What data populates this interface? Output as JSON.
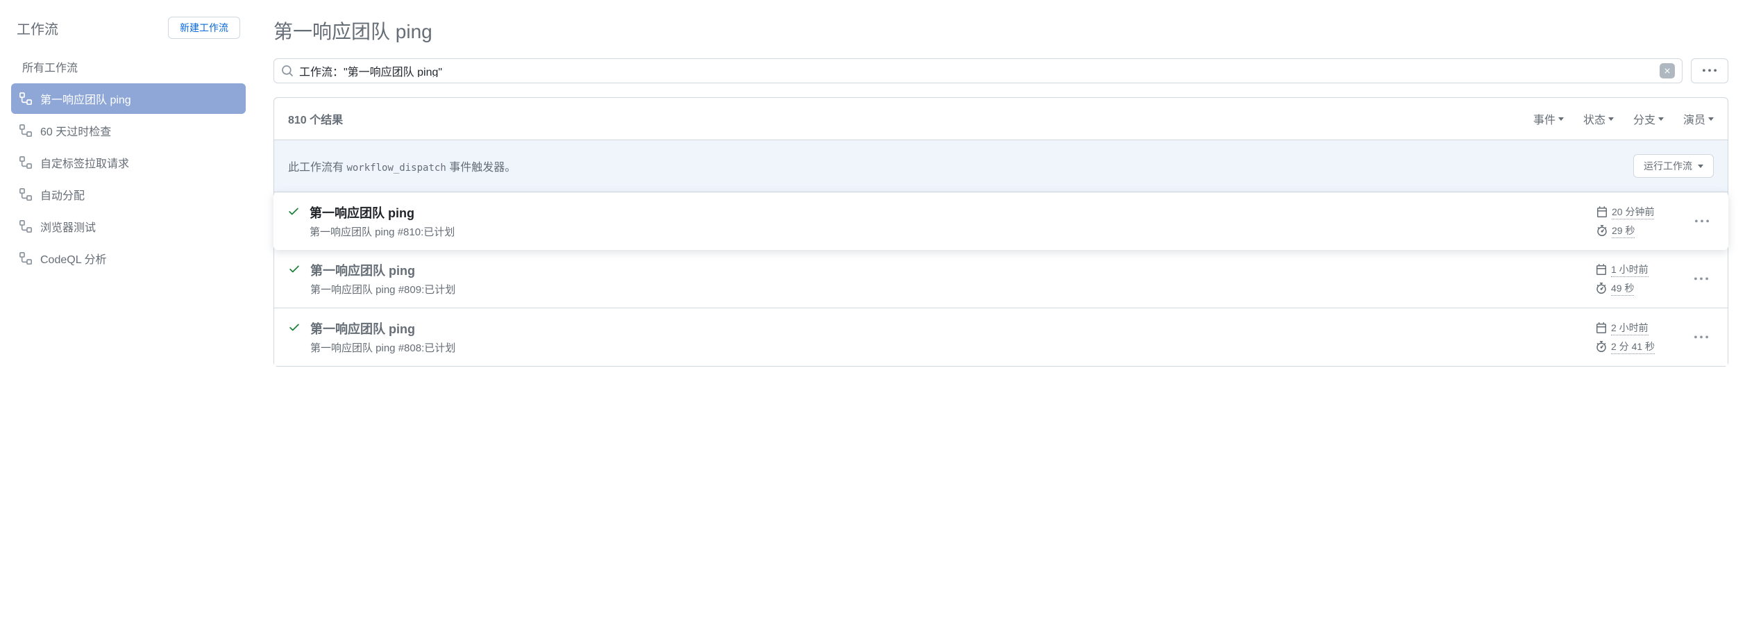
{
  "sidebar": {
    "title": "工作流",
    "new_button": "新建工作流",
    "all_label": "所有工作流",
    "items": [
      {
        "label": "第一响应团队 ping",
        "active": true
      },
      {
        "label": "60 天过时检查",
        "active": false
      },
      {
        "label": "自定标签拉取请求",
        "active": false
      },
      {
        "label": "自动分配",
        "active": false
      },
      {
        "label": "浏览器测试",
        "active": false
      },
      {
        "label": "CodeQL 分析",
        "active": false
      }
    ]
  },
  "page": {
    "title": "第一响应团队 ping",
    "search_value": "工作流：\"第一响应团队 ping\""
  },
  "results": {
    "count_label": "810 个结果",
    "filters": {
      "event": "事件",
      "status": "状态",
      "branch": "分支",
      "actor": "演员"
    },
    "dispatch": {
      "prefix": "此工作流有 ",
      "code": "workflow_dispatch",
      "suffix": " 事件触发器。",
      "run_button": "运行工作流"
    },
    "runs": [
      {
        "title": "第一响应团队 ping",
        "subtitle": "第一响应团队 ping #810:已计划",
        "time": "20 分钟前",
        "duration": "29 秒",
        "elevated": true
      },
      {
        "title": "第一响应团队 ping",
        "subtitle": "第一响应团队 ping #809:已计划",
        "time": "1 小时前",
        "duration": "49 秒",
        "elevated": false
      },
      {
        "title": "第一响应团队 ping",
        "subtitle": "第一响应团队 ping #808:已计划",
        "time": "2 小时前",
        "duration": "2 分 41 秒",
        "elevated": false
      }
    ]
  }
}
